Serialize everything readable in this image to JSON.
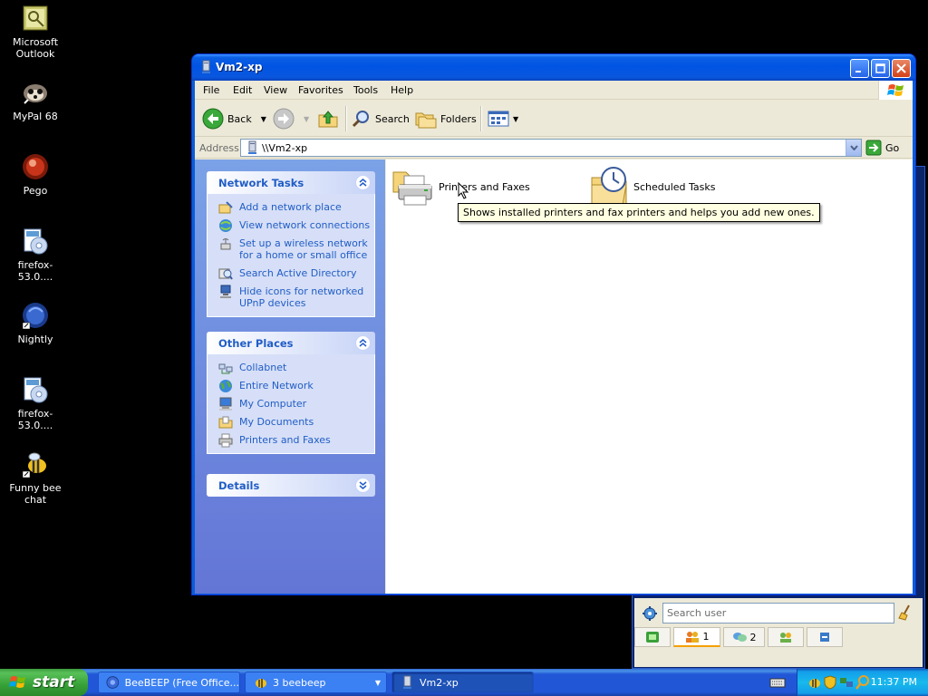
{
  "desktop": {
    "icons": [
      {
        "label": "Microsoft Outlook"
      },
      {
        "label": "MyPal 68"
      },
      {
        "label": "Pego"
      },
      {
        "label": "firefox-53.0...."
      },
      {
        "label": "Nightly"
      },
      {
        "label": "firefox-53.0...."
      },
      {
        "label": "Funny bee chat"
      }
    ]
  },
  "beebeep": {
    "search_placeholder": "Search user",
    "tabs": [
      {
        "label": ""
      },
      {
        "label": "1"
      },
      {
        "label": "2"
      },
      {
        "label": ""
      },
      {
        "label": ""
      }
    ]
  },
  "window": {
    "title": "Vm2-xp",
    "menu": [
      "File",
      "Edit",
      "View",
      "Favorites",
      "Tools",
      "Help"
    ],
    "toolbar": {
      "back": "Back",
      "search": "Search",
      "folders": "Folders"
    },
    "address": {
      "label": "Address",
      "value": "\\\\Vm2-xp",
      "go": "Go"
    },
    "taskpane": {
      "network_tasks": {
        "title": "Network Tasks",
        "items": [
          {
            "label": "Add a network place"
          },
          {
            "label": "View network connections"
          },
          {
            "label": "Set up a wireless network for a home or small office"
          },
          {
            "label": "Search Active Directory"
          },
          {
            "label": "Hide icons for networked UPnP devices"
          }
        ]
      },
      "other_places": {
        "title": "Other Places",
        "items": [
          {
            "label": "Collabnet"
          },
          {
            "label": "Entire Network"
          },
          {
            "label": "My Computer"
          },
          {
            "label": "My Documents"
          },
          {
            "label": "Printers and Faxes"
          }
        ]
      },
      "details": {
        "title": "Details"
      }
    },
    "content": {
      "items": [
        {
          "label": "Printers and Faxes"
        },
        {
          "label": "Scheduled Tasks"
        }
      ],
      "tooltip": "Shows installed printers and fax printers and helps you add new ones."
    }
  },
  "taskbar": {
    "start": "start",
    "buttons": [
      {
        "label": "BeeBEEP (Free Office..."
      },
      {
        "label": "3 beebeep"
      },
      {
        "label": "Vm2-xp"
      }
    ],
    "clock": "11:37 PM"
  },
  "colors": {
    "titlebar": "#0054e3",
    "taskpane_link": "#215dc6",
    "taskbar": "#2157d7",
    "start_green": "#36a136"
  }
}
